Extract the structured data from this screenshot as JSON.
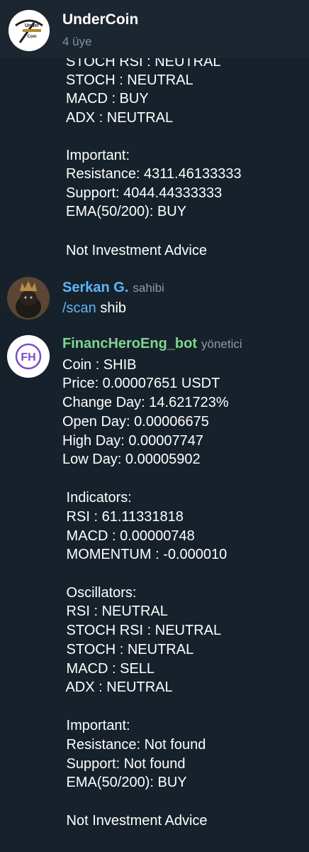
{
  "header": {
    "title": "UnderCoin",
    "subtitle": "4 üye",
    "logo_top": "Under",
    "logo_bottom": "Coin"
  },
  "msg1": {
    "lines": [
      "STOCH RSI : NEUTRAL",
      "STOCH : NEUTRAL",
      "MACD : BUY",
      "ADX : NEUTRAL",
      "",
      "Important:",
      "Resistance: 4311.46133333",
      "Support: 4044.44333333",
      "EMA(50/200): BUY",
      "",
      "Not Investment Advice"
    ]
  },
  "msg2": {
    "sender": "Serkan G.",
    "role": "sahibi",
    "command": "/scan",
    "arg": " shib"
  },
  "msg3": {
    "sender": "FinancHeroEng_bot",
    "role": "yönetici",
    "avatar_text": "FH",
    "lines": [
      "Coin : SHIB",
      "Price: 0.00007651 USDT",
      "Change Day: 14.621723%",
      "Open Day: 0.00006675",
      "High Day: 0.00007747",
      "Low Day: 0.00005902",
      "",
      " Indicators:",
      " RSI : 61.11331818",
      " MACD : 0.00000748",
      " MOMENTUM : -0.000010",
      "",
      " Oscillators:",
      " RSI : NEUTRAL",
      " STOCH RSI : NEUTRAL",
      " STOCH : NEUTRAL",
      " MACD : SELL",
      " ADX : NEUTRAL",
      "",
      " Important:",
      " Resistance: Not found",
      " Support: Not found",
      " EMA(50/200): BUY",
      "",
      " Not Investment Advice"
    ]
  },
  "colors": {
    "background": "#17212b",
    "header": "#1b2631",
    "link": "#5eb5f7",
    "bot_name": "#7fd68e",
    "muted": "#7f91a4"
  }
}
